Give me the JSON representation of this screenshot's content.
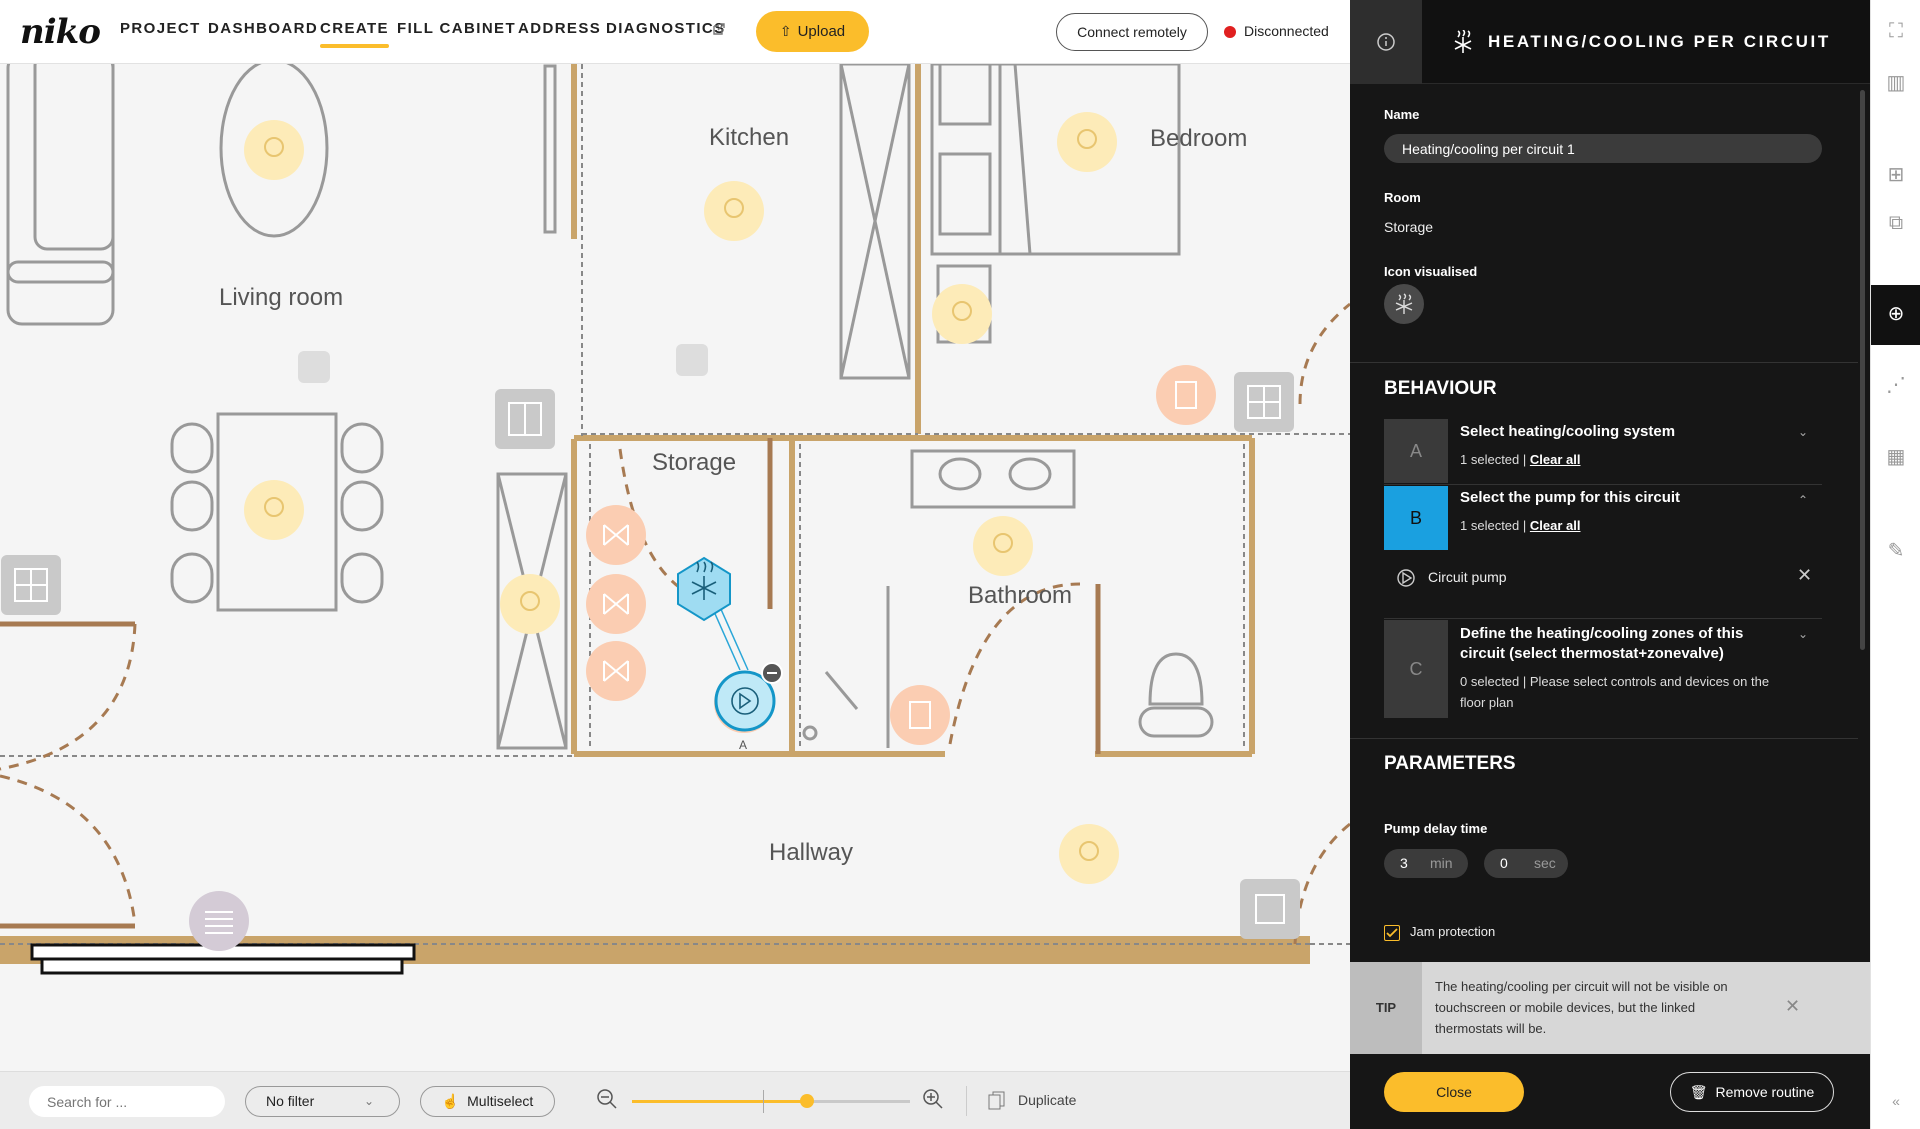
{
  "brand": {
    "logo": "niko",
    "accent": "#fbbd2b"
  },
  "nav": {
    "items": [
      "PROJECT",
      "DASHBOARD",
      "CREATE",
      "FILL CABINET",
      "ADDRESS",
      "DIAGNOSTICS"
    ],
    "active": "CREATE",
    "upload": "Upload",
    "connect": "Connect remotely",
    "status": "Disconnected",
    "status_color": "#e02020"
  },
  "plan": {
    "rooms": [
      "Kitchen",
      "Bedroom",
      "Living room",
      "Storage",
      "Bathroom",
      "Hallway"
    ],
    "pump_marker_label": "A"
  },
  "bottom": {
    "search_placeholder": "Search for ...",
    "filter": "No filter",
    "multiselect": "Multiselect",
    "zoom_level": 0.63,
    "duplicate": "Duplicate"
  },
  "panel": {
    "title": "HEATING/COOLING PER CIRCUIT",
    "name_label": "Name",
    "name_value": "Heating/cooling per circuit 1",
    "room_label": "Room",
    "room_value": "Storage",
    "icon_label": "Icon visualised",
    "behaviour_title": "BEHAVIOUR",
    "steps": [
      {
        "letter": "A",
        "title": "Select heating/cooling system",
        "selected": "1 selected |",
        "clear": "Clear all"
      },
      {
        "letter": "B",
        "title": "Select the pump for this circuit",
        "selected": "1 selected |",
        "clear": "Clear all",
        "item": "Circuit pump"
      },
      {
        "letter": "C",
        "title": "Define the heating/cooling zones of this circuit (select thermostat+zonevalve)",
        "selected": "0 selected | Please select controls and devices on the floor plan"
      }
    ],
    "parameters_title": "PARAMETERS",
    "pump_delay_label": "Pump delay time",
    "pump_delay_min": "3",
    "min_unit": "min",
    "pump_delay_sec": "0",
    "sec_unit": "sec",
    "jam_protection": "Jam protection",
    "tip_label": "TIP",
    "tip_text": "The heating/cooling per circuit will not be visible on touchscreen or mobile devices, but the linked thermostats will be.",
    "close": "Close",
    "remove": "Remove routine"
  }
}
